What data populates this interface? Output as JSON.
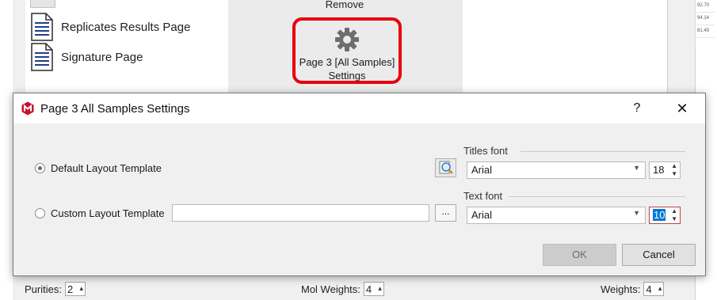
{
  "background": {
    "pages": [
      {
        "label": "Replicates Results Page"
      },
      {
        "label": "Signature Page"
      }
    ],
    "ribbon": {
      "remove_label": "Remove",
      "settings_label_line1": "Page 3 [All Samples]",
      "settings_label_line2": "Settings",
      "highlight_color": "#e8000d"
    },
    "numbers_column": [
      "92.70",
      "94.14",
      "81.49"
    ],
    "bottom_fields": {
      "purities_label": "Purities:",
      "purities_value": "2",
      "mol_weights_label": "Mol Weights:",
      "mol_weights_value": "4",
      "weights_label": "Weights:",
      "weights_value": "4"
    }
  },
  "dialog": {
    "title": "Page 3 All Samples Settings",
    "help_label": "?",
    "close_label": "✕",
    "default_template_label": "Default Layout Template",
    "custom_template_label": "Custom Layout Template",
    "custom_template_path": "",
    "browse_label": "...",
    "titles_font": {
      "group_label": "Titles font",
      "family": "Arial",
      "size": "18"
    },
    "text_font": {
      "group_label": "Text font",
      "family": "Arial",
      "size": "10"
    },
    "ok_label": "OK",
    "cancel_label": "Cancel",
    "selected_template": "default"
  }
}
